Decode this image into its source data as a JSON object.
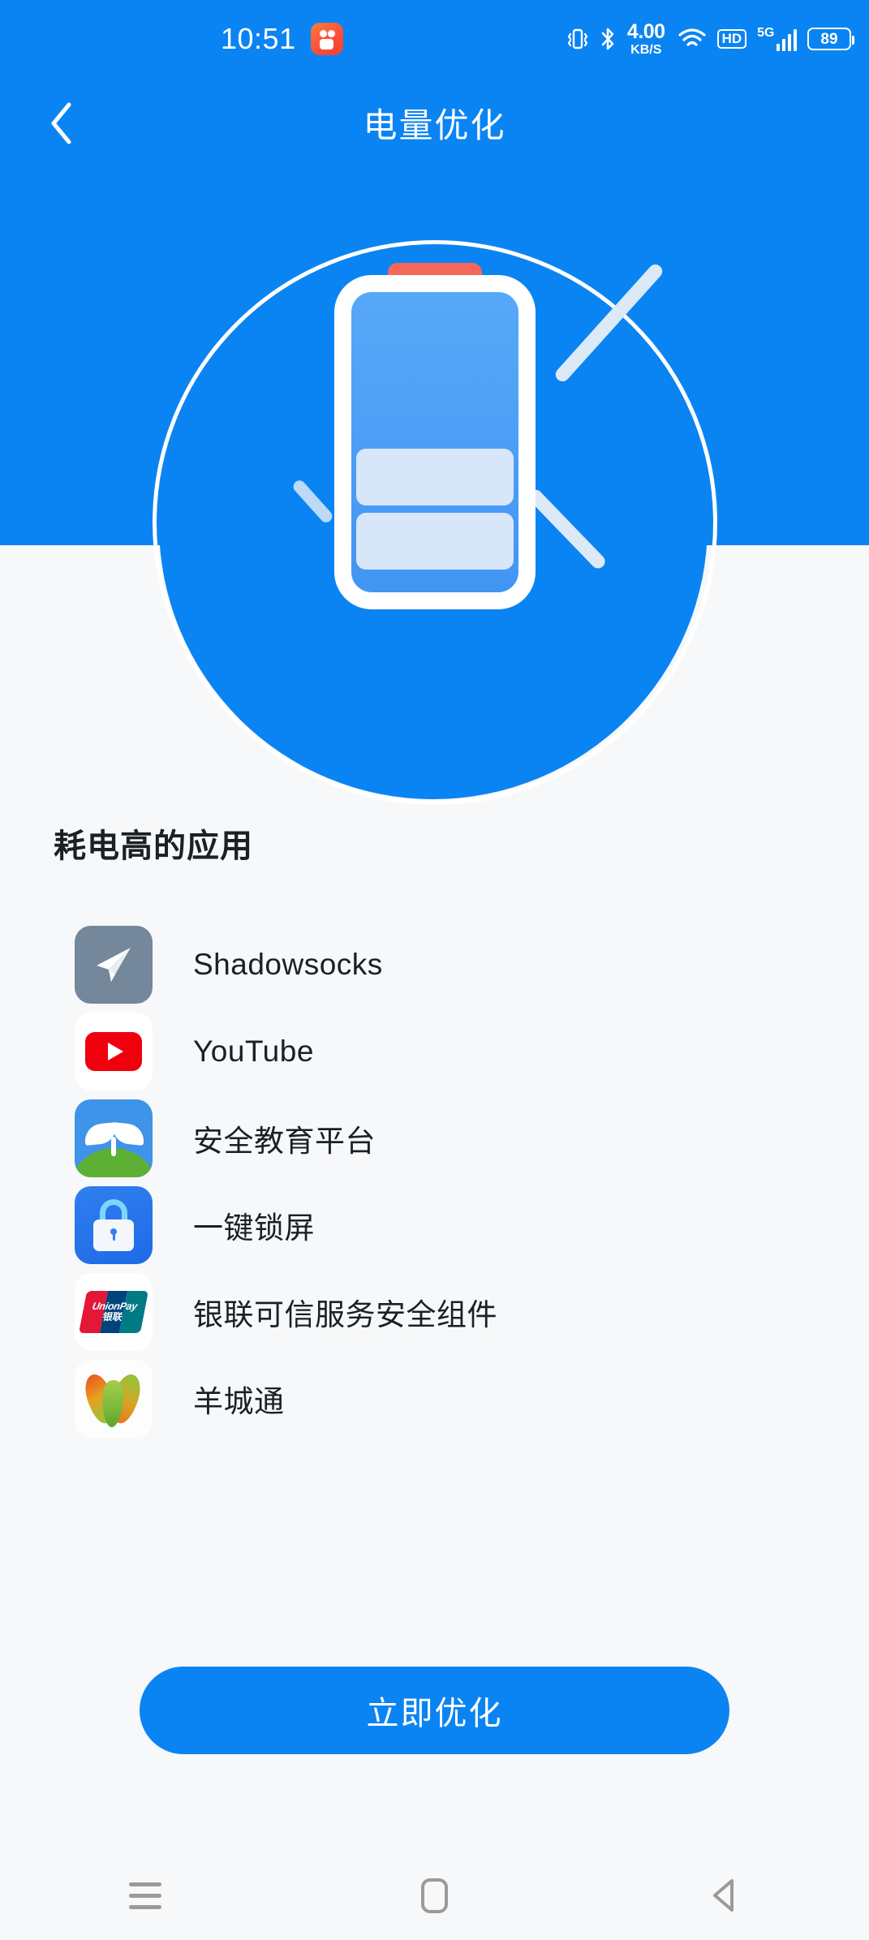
{
  "status_bar": {
    "time": "10:51",
    "app_icon": "video-app-icon",
    "icons": {
      "vibrate": "vibrate-icon",
      "bluetooth": "bluetooth-icon",
      "wifi": "wifi-icon",
      "hd": "HD",
      "network_type": "5G"
    },
    "network_speed_value": "4.00",
    "network_speed_unit": "KB/S",
    "battery_percent": "89"
  },
  "header": {
    "title": "电量优化",
    "back_icon": "chevron-left-icon",
    "accent_color": "#0b84f3"
  },
  "hero": {
    "illustration": "battery-optimization-illustration",
    "battery_cap_color": "#f4685c",
    "battery_fill_color": "#4ea2f7",
    "circle_color": "#0b84f3"
  },
  "section": {
    "title": "耗电高的应用"
  },
  "apps": [
    {
      "name": "Shadowsocks",
      "icon": "shadowsocks-icon"
    },
    {
      "name": "YouTube",
      "icon": "youtube-icon"
    },
    {
      "name": "安全教育平台",
      "icon": "safety-education-icon"
    },
    {
      "name": "一键锁屏",
      "icon": "one-key-lock-screen-icon"
    },
    {
      "name": "银联可信服务安全组件",
      "icon": "unionpay-icon"
    },
    {
      "name": "羊城通",
      "icon": "yangchengtong-icon"
    }
  ],
  "unionpay_logo": {
    "line1": "UnionPay",
    "line2": "银联"
  },
  "cta": {
    "label": "立即优化",
    "color": "#0b84f3"
  },
  "navbar": {
    "recents": "recents-icon",
    "home": "home-icon",
    "back": "back-icon"
  }
}
